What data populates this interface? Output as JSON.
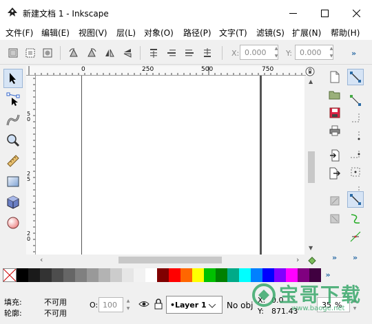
{
  "window": {
    "title": "新建文档 1 - Inkscape",
    "minimize_glyph": "—",
    "maximize_glyph": "☐",
    "close_glyph": "✕"
  },
  "menu": [
    "文件(F)",
    "编辑(E)",
    "视图(V)",
    "层(L)",
    "对象(O)",
    "路径(P)",
    "文字(T)",
    "滤镜(S)",
    "扩展(N)",
    "帮助(H)"
  ],
  "toolbar": {
    "x_label": "X:",
    "x_value": "0.000",
    "y_label": "Y:",
    "y_value": "0.000",
    "overflow": "»"
  },
  "ruler": {
    "h_labels": [
      "0",
      "250",
      "500",
      "750"
    ],
    "v_labels": [
      "5\n0",
      "2\n5",
      "2\n0"
    ]
  },
  "left_tools": [
    {
      "name": "selector",
      "active": true
    },
    {
      "name": "node",
      "active": false
    },
    {
      "name": "tweak",
      "active": false
    },
    {
      "name": "zoom",
      "active": false
    },
    {
      "name": "measure",
      "active": false
    },
    {
      "name": "rectangle",
      "active": false
    },
    {
      "name": "box3d",
      "active": false
    },
    {
      "name": "ellipse",
      "active": false
    }
  ],
  "palette": {
    "colors": [
      "#000000",
      "#1a1a1a",
      "#333333",
      "#4d4d4d",
      "#666666",
      "#808080",
      "#999999",
      "#b3b3b3",
      "#cccccc",
      "#e6e6e6",
      "#f2f2f2",
      "#ffffff",
      "#800000",
      "#ff0000",
      "#ff6600",
      "#ffff00",
      "#00c000",
      "#008000",
      "#00aa88",
      "#00ffff",
      "#0080ff",
      "#0000ff",
      "#8000ff",
      "#ff00ff",
      "#800080",
      "#400040"
    ],
    "overflow": "»"
  },
  "status": {
    "fill_label": "填充:",
    "fill_value": "不可用",
    "stroke_label": "轮廓:",
    "stroke_value": "不可用",
    "opacity_label": "O:",
    "opacity_value": "100",
    "layer_value": "•Layer 1",
    "message": "No obj",
    "x_label": "X:",
    "x_value": "0.0",
    "y_label": "Y:",
    "y_value": "871.43",
    "zoom_value": "35"
  },
  "watermark": {
    "main": "宝哥下载",
    "sub": "www.baoge.net"
  }
}
